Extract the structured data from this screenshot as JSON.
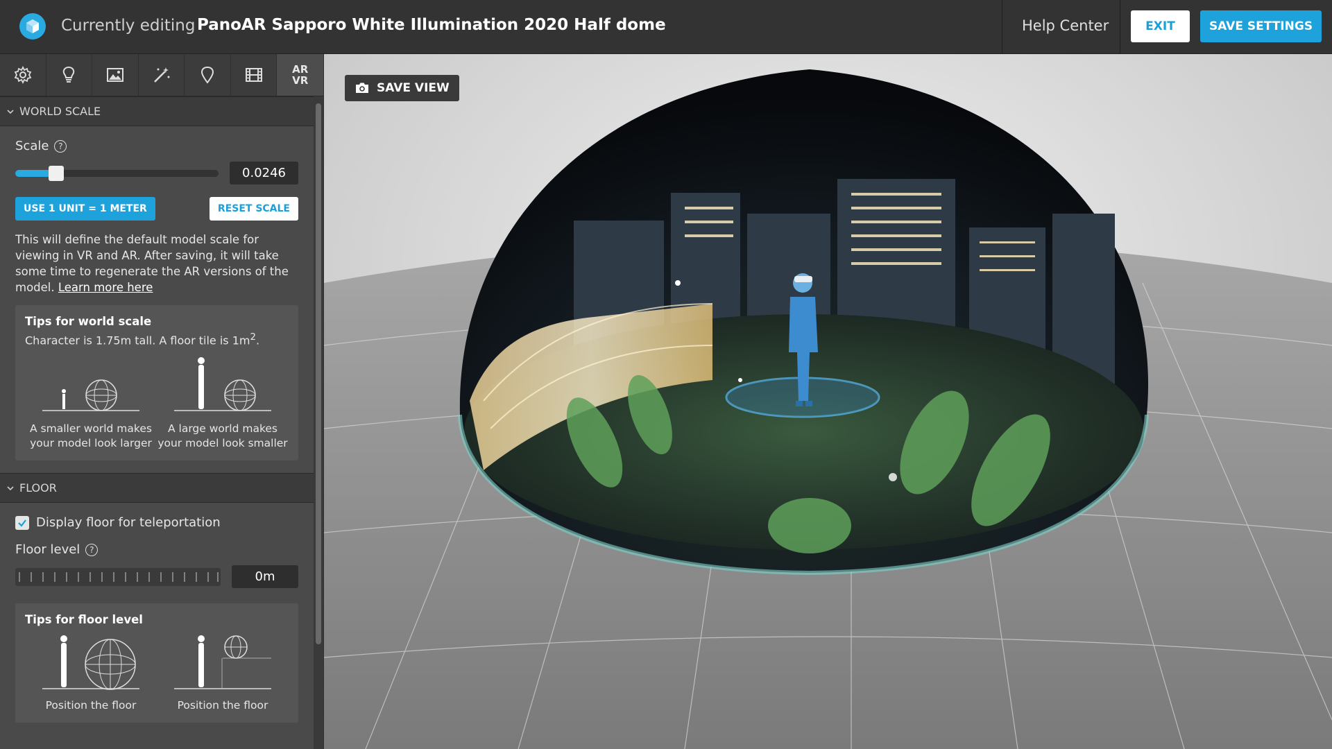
{
  "header": {
    "editing_label": "Currently editing",
    "title": "PanoAR Sapporo White Illumination 2020 Half dome",
    "help_center": "Help Center",
    "exit": "EXIT",
    "save_settings": "SAVE SETTINGS",
    "accent": "#1ea2dc"
  },
  "toolbar": {
    "tools": [
      "gear-icon",
      "lightbulb-icon",
      "image-icon",
      "magic-wand-icon",
      "pin-icon",
      "film-icon"
    ],
    "arvr_top": "AR",
    "arvr_bottom": "VR"
  },
  "world_scale": {
    "section_title": "WORLD SCALE",
    "scale_label": "Scale",
    "scale_value": "0.0246",
    "slider_fraction": 0.2,
    "use_unit_button": "USE 1 UNIT = 1 METER",
    "reset_button": "RESET SCALE",
    "description": "This will define the default model scale for viewing in VR and AR. After saving, it will take some time to regenerate the AR versions of the model.",
    "learn_more": "Learn more here",
    "tips_title": "Tips for world scale",
    "tips_text_prefix": "Character is 1.75m tall. A floor tile is 1m",
    "tips_text_sup": "2",
    "tips_text_suffix": ".",
    "tip_small": "A smaller world makes your model look larger",
    "tip_large": "A large world makes your model look smaller"
  },
  "floor": {
    "section_title": "FLOOR",
    "display_floor_label": "Display floor for teleportation",
    "display_floor_checked": true,
    "floor_level_label": "Floor level",
    "floor_level_value": "0m",
    "tips_title": "Tips for floor level",
    "tip_left": "Position the floor",
    "tip_right": "Position the floor"
  },
  "viewport": {
    "save_view": "SAVE VIEW"
  }
}
